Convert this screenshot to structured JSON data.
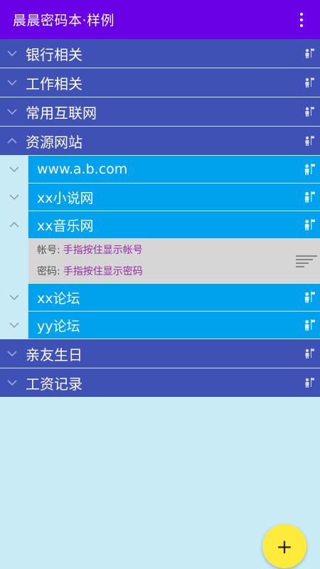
{
  "appbar": {
    "title": "晨晨密码本·样例",
    "menu_icon": "more-vert-icon"
  },
  "groups_top": [
    {
      "label": "银行相关",
      "expanded": false
    },
    {
      "label": "工作相关",
      "expanded": false
    },
    {
      "label": "常用互联网",
      "expanded": false
    },
    {
      "label": "资源网站",
      "expanded": true
    }
  ],
  "children": [
    {
      "label": "www.a.b.com"
    },
    {
      "label": "xx小说网"
    },
    {
      "label": "xx音乐网",
      "expanded": true
    },
    {
      "label": "xx论坛"
    },
    {
      "label": "yy论坛"
    }
  ],
  "detail": {
    "account_label": "帐号:",
    "account_value": "手指按住显示帐号",
    "password_label": "密码:",
    "password_value": "手指按住显示密码"
  },
  "groups_bottom": [
    {
      "label": "亲友生日",
      "expanded": false
    },
    {
      "label": "工资记录",
      "expanded": false
    }
  ],
  "fab": {
    "label": "+"
  },
  "colors": {
    "appbar": "#6a00e6",
    "group": "#3f51b5",
    "child": "#00a2ee",
    "background": "#c9ebf6",
    "fab": "#ffeb3b",
    "detail_value": "#9c27b0"
  }
}
